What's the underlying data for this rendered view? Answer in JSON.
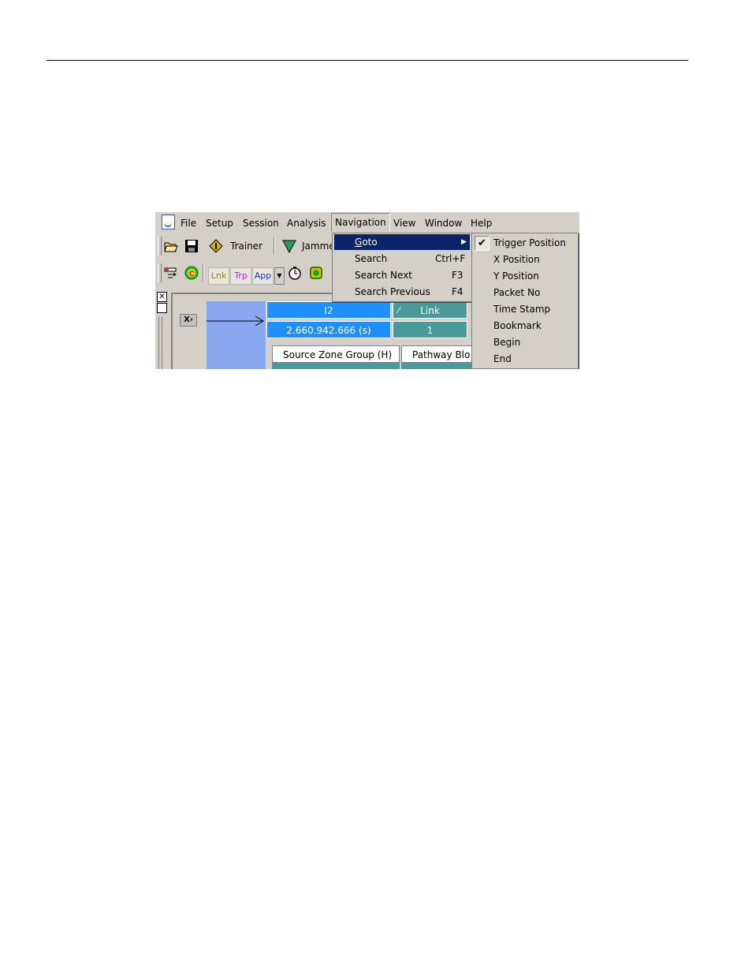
{
  "menubar": {
    "items": [
      {
        "label": "File"
      },
      {
        "label": "Setup"
      },
      {
        "label": "Session"
      },
      {
        "label": "Analysis"
      },
      {
        "label": "Navigation"
      },
      {
        "label": "View"
      },
      {
        "label": "Window"
      },
      {
        "label": "Help"
      }
    ]
  },
  "toolbar": {
    "trainer_label": "Trainer",
    "jammer_label": "Jamme",
    "lnk_label": "Lnk",
    "trp_label": "Trp",
    "app_label": "App"
  },
  "navigation_menu": {
    "items": [
      {
        "label": "Goto",
        "accel_char": "G",
        "shortcut": "",
        "submenu": true,
        "highlighted": true
      },
      {
        "label": "Search",
        "shortcut": "Ctrl+F"
      },
      {
        "label": "Search Next",
        "shortcut": "F3"
      },
      {
        "label": "Search Previous",
        "shortcut": "F4"
      }
    ]
  },
  "goto_submenu": {
    "items": [
      {
        "label": "Trigger Position",
        "checked": true
      },
      {
        "label": "X Position"
      },
      {
        "label": "Y Position"
      },
      {
        "label": "Packet No"
      },
      {
        "label": "Time Stamp"
      },
      {
        "label": "Bookmark"
      },
      {
        "label": "Begin"
      },
      {
        "label": "End"
      }
    ]
  },
  "trace": {
    "i2_label": "I2",
    "time_value": "2.660.942.666 (s)",
    "link_label": "Link",
    "link_value": "1",
    "tab1": "Source Zone Group (H)",
    "tab2": "Pathway Blo",
    "colors": {
      "blue_cell": "#1e90ff",
      "teal_cell": "#4a9a9a",
      "graph_bg": "#8aa8f0",
      "menu_highlight": "#0a246a"
    }
  }
}
